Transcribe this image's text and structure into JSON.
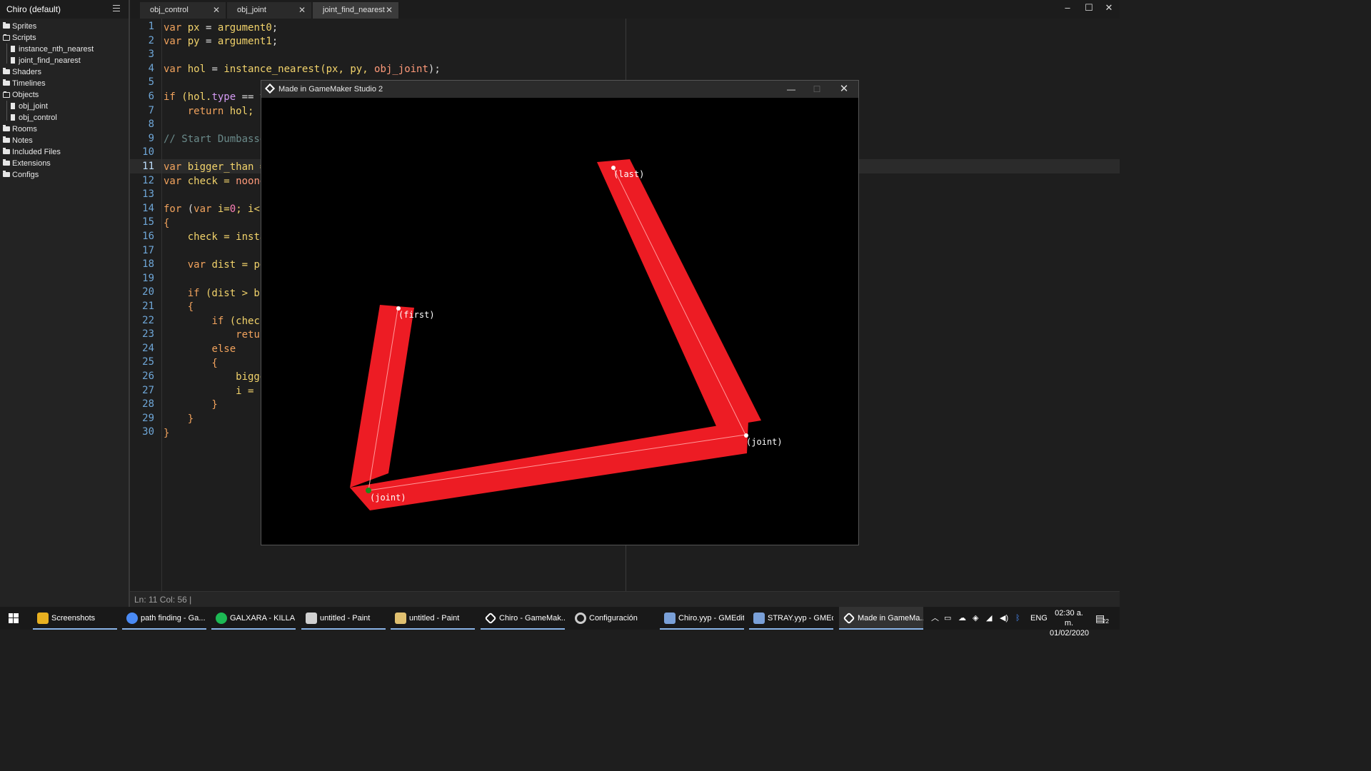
{
  "sidebar": {
    "title": "Chiro (default)",
    "tree": [
      {
        "label": "Sprites",
        "type": "folder"
      },
      {
        "label": "Scripts",
        "type": "folder-open"
      },
      {
        "label": "instance_nth_nearest",
        "type": "file"
      },
      {
        "label": "joint_find_nearest",
        "type": "file"
      },
      {
        "label": "Shaders",
        "type": "folder"
      },
      {
        "label": "Timelines",
        "type": "folder"
      },
      {
        "label": "Objects",
        "type": "folder-open"
      },
      {
        "label": "obj_joint",
        "type": "file"
      },
      {
        "label": "obj_control",
        "type": "file"
      },
      {
        "label": "Rooms",
        "type": "folder"
      },
      {
        "label": "Notes",
        "type": "folder"
      },
      {
        "label": "Included Files",
        "type": "folder"
      },
      {
        "label": "Extensions",
        "type": "folder"
      },
      {
        "label": "Configs",
        "type": "folder"
      }
    ]
  },
  "tabs": [
    {
      "label": "obj_control",
      "active": false
    },
    {
      "label": "obj_joint",
      "active": false
    },
    {
      "label": "joint_find_nearest",
      "active": true
    }
  ],
  "window_controls": {
    "minimize": "–",
    "maximize": "☐",
    "close": "✕"
  },
  "editor": {
    "current_line": 11,
    "lines": [
      "1",
      "2",
      "3",
      "4",
      "5",
      "6",
      "7",
      "8",
      "9",
      "10",
      "11",
      "12",
      "13",
      "14",
      "15",
      "16",
      "17",
      "18",
      "19",
      "20",
      "21",
      "22",
      "23",
      "24",
      "25",
      "26",
      "27",
      "28",
      "29",
      "30"
    ],
    "code": {
      "l1": [
        "var",
        " ",
        "px",
        " = ",
        "argument0",
        ";"
      ],
      "l2": [
        "var",
        " ",
        "py",
        " = ",
        "argument1",
        ";"
      ],
      "l4": [
        "var",
        " ",
        "hol",
        " = ",
        "instance_nearest",
        "(px, py, ",
        "obj_joint",
        ");"
      ],
      "l6": [
        "if",
        " (hol.",
        "type",
        " == t"
      ],
      "l7": [
        "    ",
        "return",
        " hol;"
      ],
      "l9": [
        "// Start Dumbasse"
      ],
      "l11": [
        "var",
        " bigger_than ="
      ],
      "l12": [
        "var",
        " check = ",
        "noone"
      ],
      "l14": [
        "for",
        " (",
        "var",
        " i=",
        "0",
        "; i<i"
      ],
      "l15": [
        "{"
      ],
      "l16": [
        "    check = ",
        "insta"
      ],
      "l18": [
        "    ",
        "var",
        " dist = po"
      ],
      "l20": [
        "    ",
        "if",
        " (dist > bi"
      ],
      "l21": [
        "    {"
      ],
      "l22": [
        "        ",
        "if",
        " (check"
      ],
      "l23": [
        "            ",
        "retur"
      ],
      "l24": [
        "        ",
        "else"
      ],
      "l25": [
        "        {"
      ],
      "l26": [
        "            bigge"
      ],
      "l27": [
        "            i = -"
      ],
      "l28": [
        "        }"
      ],
      "l29": [
        "    }"
      ],
      "l30": [
        "}"
      ]
    }
  },
  "status_bar": {
    "text": "Ln:   11 Col:   56 |"
  },
  "game_window": {
    "title": "Made in GameMaker Studio 2",
    "labels": {
      "first": "(first)",
      "last": "(last)",
      "joint1": "(joint)",
      "joint2": "(joint)"
    },
    "colors": {
      "limb": "#ed1c24",
      "background": "#000000",
      "point": "#ffffff",
      "start_point": "#1a8a1a"
    }
  },
  "taskbar": {
    "items": [
      {
        "label": "Screenshots",
        "color": "#e8b020"
      },
      {
        "label": "path finding - Ga...",
        "color": "#4a8af4"
      },
      {
        "label": "GALXARA - KILLA ...",
        "color": "#1db954"
      },
      {
        "label": "untitled - Paint",
        "color": "#d0d0d0"
      },
      {
        "label": "untitled - Paint",
        "color": "#e0c070"
      },
      {
        "label": "Chiro - GameMak...",
        "color": "#ffffff"
      },
      {
        "label": "Configuración",
        "color": "#cccccc"
      },
      {
        "label": "Chiro.yyp - GMEdit",
        "color": "#7aa0d8"
      },
      {
        "label": "STRAY.yyp - GMEdit",
        "color": "#7aa0d8"
      },
      {
        "label": "Made in GameMa...",
        "color": "#ffffff"
      }
    ],
    "tray": {
      "language": "ENG",
      "time": "02:30 a. m.",
      "date": "01/02/2020",
      "notifications": "22"
    }
  }
}
